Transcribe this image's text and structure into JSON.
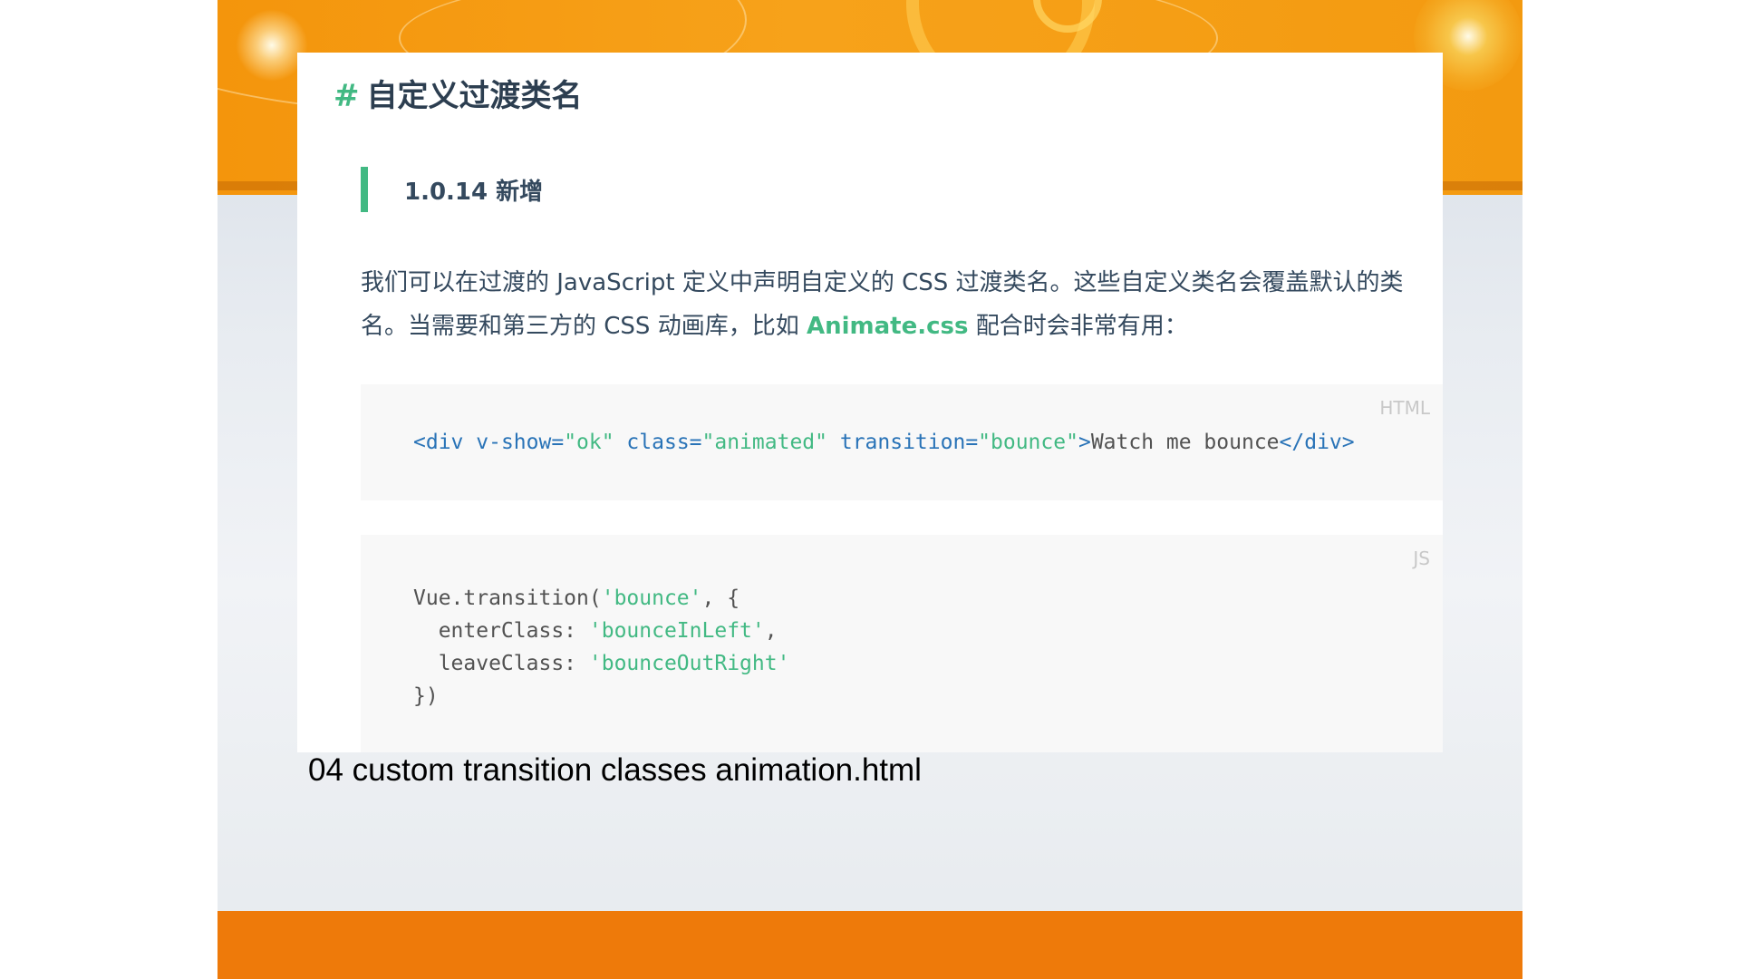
{
  "section": {
    "hash": "#",
    "title": "自定义过渡类名",
    "version": "1.0.14 新增",
    "paragraph_before": "我们可以在过渡的 JavaScript 定义中声明自定义的 CSS 过渡类名。这些自定义类名会覆盖默认的类名。当需要和第三方的 CSS 动画库，比如 ",
    "link_text": "Animate.css",
    "paragraph_after": " 配合时会非常有用："
  },
  "code_html": {
    "lang": "HTML",
    "tag_open": "<div ",
    "attr1": "v-show=",
    "val1": "\"ok\"",
    "attr2": " class=",
    "val2": "\"animated\"",
    "attr3": " transition=",
    "val3": "\"bounce\"",
    "tag_close": ">",
    "content": "Watch me bounce",
    "end_tag": "</div>"
  },
  "code_js": {
    "lang": "JS",
    "l1_a": "Vue.transition(",
    "l1_b": "'bounce'",
    "l1_c": ", {",
    "l2_a": "  enterClass: ",
    "l2_b": "'bounceInLeft'",
    "l2_c": ",",
    "l3_a": "  leaveClass: ",
    "l3_b": "'bounceOutRight'",
    "l4": "})"
  },
  "caption": "04 custom transition classes animation.html",
  "colors": {
    "accent": "#42b983",
    "heading": "#2c3e50",
    "header_orange": "#f4950c",
    "footer_orange": "#ee7a0a",
    "code_bg": "#f8f8f8"
  }
}
